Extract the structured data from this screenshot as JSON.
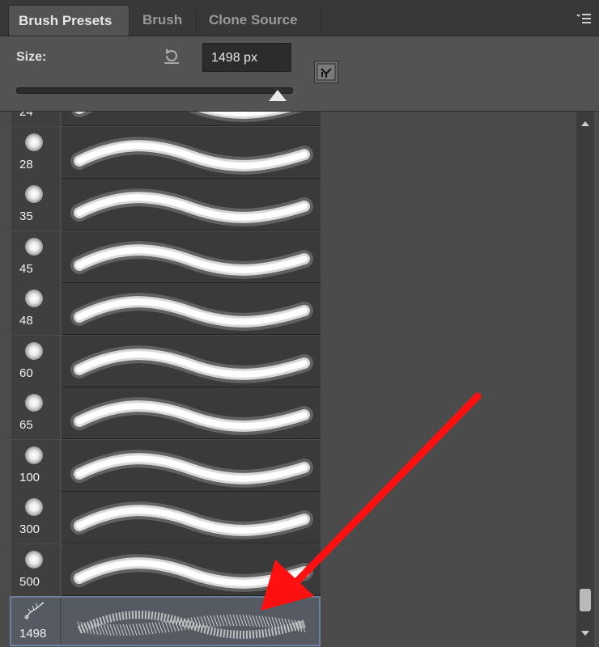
{
  "tabs": [
    {
      "label": "Brush Presets"
    },
    {
      "label": "Brush"
    },
    {
      "label": "Clone Source"
    }
  ],
  "icons": {
    "panel_menu": "panel-menu-icon",
    "reset": "reset-size-icon",
    "new_preset": "new-preset-icon",
    "scroll_up": "scroll-up-icon",
    "scroll_down": "scroll-down-icon"
  },
  "size": {
    "label": "Size:",
    "value": "1498 px",
    "slider_fraction": 0.95
  },
  "presets": [
    {
      "size": "24"
    },
    {
      "size": "28"
    },
    {
      "size": "35"
    },
    {
      "size": "45"
    },
    {
      "size": "48"
    },
    {
      "size": "60"
    },
    {
      "size": "65"
    },
    {
      "size": "100"
    },
    {
      "size": "300"
    },
    {
      "size": "500"
    },
    {
      "size": "1498",
      "selected": true
    }
  ],
  "colors": {
    "annotation_arrow": "#ff1010",
    "selection": "#6d7e98"
  }
}
